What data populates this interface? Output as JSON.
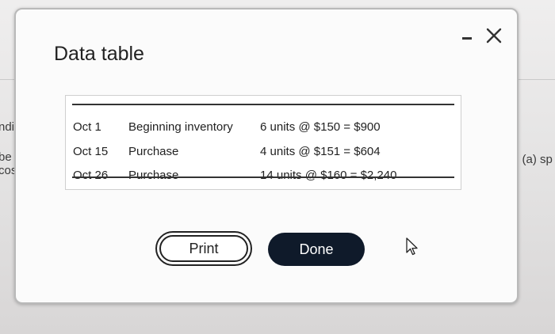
{
  "background": {
    "left_fragments": [
      "ndi",
      "be",
      "cos"
    ],
    "right_fragment": "g (a) sp"
  },
  "modal": {
    "title": "Data table",
    "controls": {
      "minimize_icon": "minimize-icon",
      "close_icon": "close-icon"
    },
    "table": {
      "rows": [
        {
          "date": "Oct 1",
          "description": "Beginning inventory",
          "calculation": "6 units @ $150 = $900"
        },
        {
          "date": "Oct 15",
          "description": "Purchase",
          "calculation": "4 units @ $151 = $604"
        },
        {
          "date": "Oct 26",
          "description": "Purchase",
          "calculation": "14 units @ $160 = $2,240"
        }
      ]
    },
    "buttons": {
      "print_label": "Print",
      "done_label": "Done"
    }
  },
  "colors": {
    "done_button_bg": "#0f1a2a",
    "modal_bg": "#fbfbfb"
  }
}
